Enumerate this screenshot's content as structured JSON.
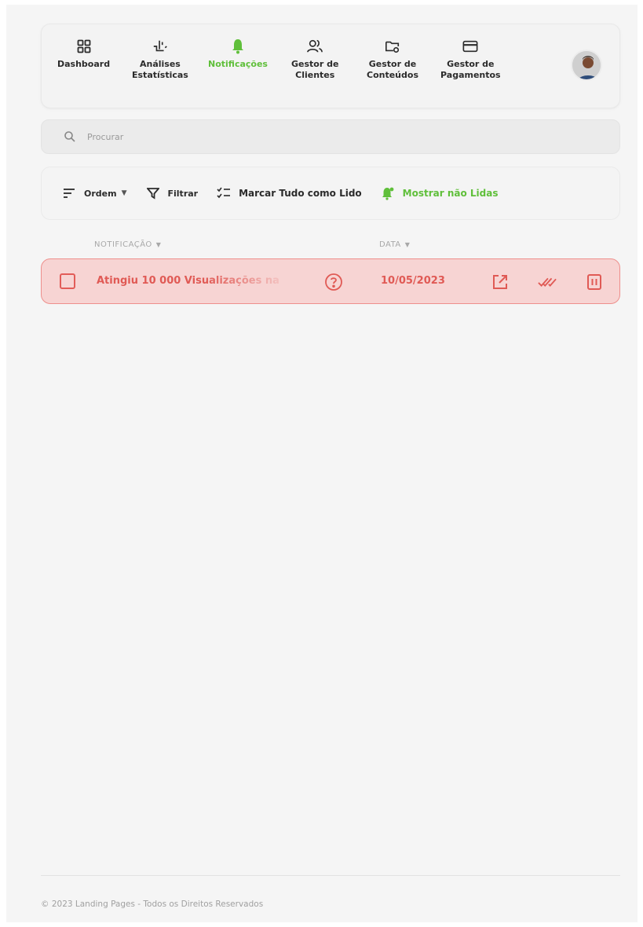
{
  "nav": {
    "items": [
      {
        "label": "Dashboard",
        "icon": "dashboard-icon"
      },
      {
        "label": "Análises\nEstatísticas",
        "icon": "analytics-icon"
      },
      {
        "label": "Notificações",
        "icon": "bell-icon",
        "active": true
      },
      {
        "label": "Gestor de\nClientes",
        "icon": "users-icon"
      },
      {
        "label": "Gestor de\nConteúdos",
        "icon": "folder-settings-icon"
      },
      {
        "label": "Gestor de\nPagamentos",
        "icon": "credit-card-icon"
      }
    ],
    "avatar_icon": "user-avatar"
  },
  "search": {
    "placeholder": "Procurar"
  },
  "toolbar": {
    "order_label": "Ordem",
    "filter_label": "Filtrar",
    "mark_all_label": "Marcar Tudo como Lido",
    "show_unread_label": "Mostrar não Lidas"
  },
  "table": {
    "headers": {
      "notification": "NOTIFICAÇÃO",
      "date": "DATA"
    },
    "rows": [
      {
        "title": "Atingiu 10 000 Visualizações na",
        "date": "10/05/2023"
      }
    ]
  },
  "footer": {
    "text": "© 2023 Landing Pages - Todos os Direitos Reservados"
  },
  "colors": {
    "accent_green": "#5fbf3a",
    "alert_red": "#e05a55",
    "alert_bg": "#f7d4d3"
  }
}
